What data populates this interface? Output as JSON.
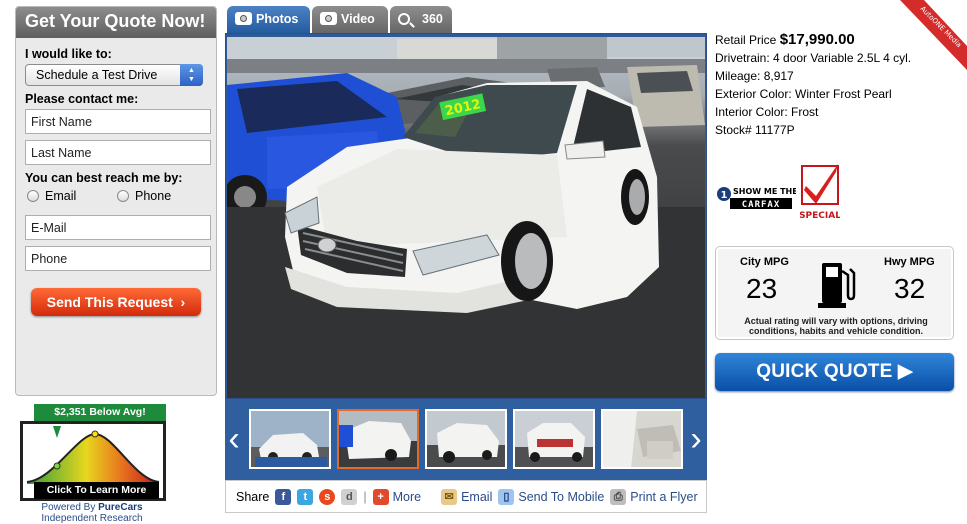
{
  "quote_form": {
    "header": "Get Your Quote Now!",
    "i_would_like": "I would like to:",
    "selected_option": "Schedule a Test Drive",
    "contact_label": "Please contact me:",
    "first_name_placeholder": "First Name",
    "last_name_placeholder": "Last Name",
    "reach_label": "You can best reach me by:",
    "radio_email": "Email",
    "radio_phone": "Phone",
    "email_placeholder": "E-Mail",
    "phone_placeholder": "Phone",
    "send_label": "Send This Request"
  },
  "price_gauge": {
    "badge": "$2,351 Below Avg!",
    "cta": "Click To Learn More",
    "powered_by": "Powered By",
    "brand": "PureCars",
    "sub": "Independent Research"
  },
  "tabs": [
    {
      "label": "Photos",
      "icon": "camera-icon",
      "active": true
    },
    {
      "label": "Video",
      "icon": "video-camera-icon",
      "active": false
    },
    {
      "label": "360",
      "icon": "magnifier-icon",
      "active": false
    }
  ],
  "photo": {
    "windshield_sticker": "2012"
  },
  "share_bar": {
    "share": "Share",
    "more": "More",
    "email": "Email",
    "send_to_mobile": "Send To Mobile",
    "print_flyer": "Print a Flyer"
  },
  "details": {
    "retail_label": "Retail Price",
    "retail_price": "$17,990.00",
    "drivetrain": "Drivetrain: 4 door Variable 2.5L 4 cyl.",
    "mileage": "Mileage: 8,917",
    "exterior": "Exterior Color: Winter Frost Pearl",
    "interior": "Interior Color: Frost",
    "stock": "Stock# 11177P"
  },
  "carfax": {
    "line1": "SHOW ME THE",
    "logo": "CARFAX",
    "special": "SPECIAL"
  },
  "mpg": {
    "city_label": "City MPG",
    "city_value": "23",
    "hwy_label": "Hwy MPG",
    "hwy_value": "32",
    "note": "Actual rating will vary with options, driving conditions, habits and vehicle condition."
  },
  "quick_quote": "QUICK QUOTE",
  "corner_ribbon": "AutoONE Media",
  "colors": {
    "tab_active": "#245ca0",
    "send_button": "#e0401a",
    "quick_quote": "#0a4fa8",
    "gauge_badge": "#1e8a3c"
  }
}
